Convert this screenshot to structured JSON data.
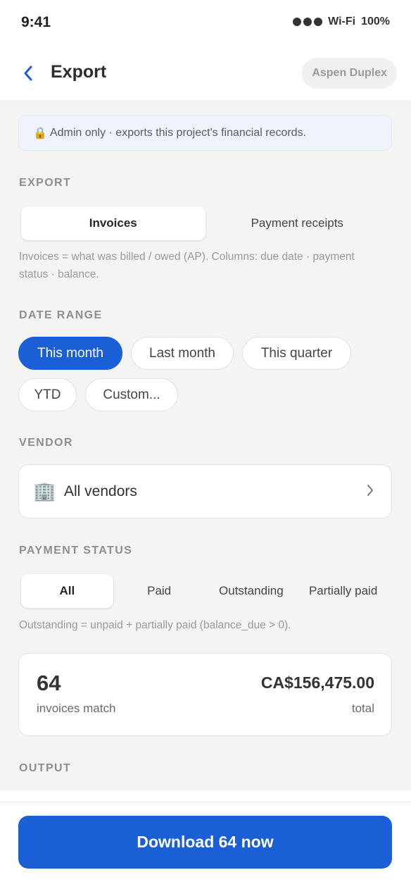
{
  "status_bar": {
    "time": "9:41",
    "wifi": "Wi-Fi",
    "battery": "100%"
  },
  "nav": {
    "title": "Export",
    "project": "Aspen Duplex",
    "back_icon": "chevron-left-icon"
  },
  "notice": {
    "icon": "🔒",
    "text": "Admin only · exports this project's financial records."
  },
  "export_section": {
    "label": "EXPORT",
    "options": [
      "Invoices",
      "Payment receipts"
    ],
    "selected": "Invoices",
    "hint": "Invoices = what was billed / owed (AP). Columns: due date · payment status · balance."
  },
  "date_range": {
    "label": "DATE RANGE",
    "options": [
      "This month",
      "Last month",
      "This quarter",
      "YTD",
      "Custom..."
    ],
    "selected": "This month"
  },
  "vendor": {
    "label": "VENDOR",
    "icon": "🏢",
    "value": "All vendors"
  },
  "payment_status": {
    "label": "PAYMENT STATUS",
    "options": [
      "All",
      "Paid",
      "Outstanding",
      "Partially paid"
    ],
    "selected": "All",
    "hint": "Outstanding = unpaid + partially paid (balance_due > 0)."
  },
  "summary": {
    "count": "64",
    "count_label": "invoices match",
    "total": "CA$156,475.00",
    "total_label": "total"
  },
  "output": {
    "label": "OUTPUT"
  },
  "action": {
    "download_label": "Download 64 now"
  },
  "colors": {
    "accent": "#1a5fd6",
    "background": "#f4f4f3"
  }
}
